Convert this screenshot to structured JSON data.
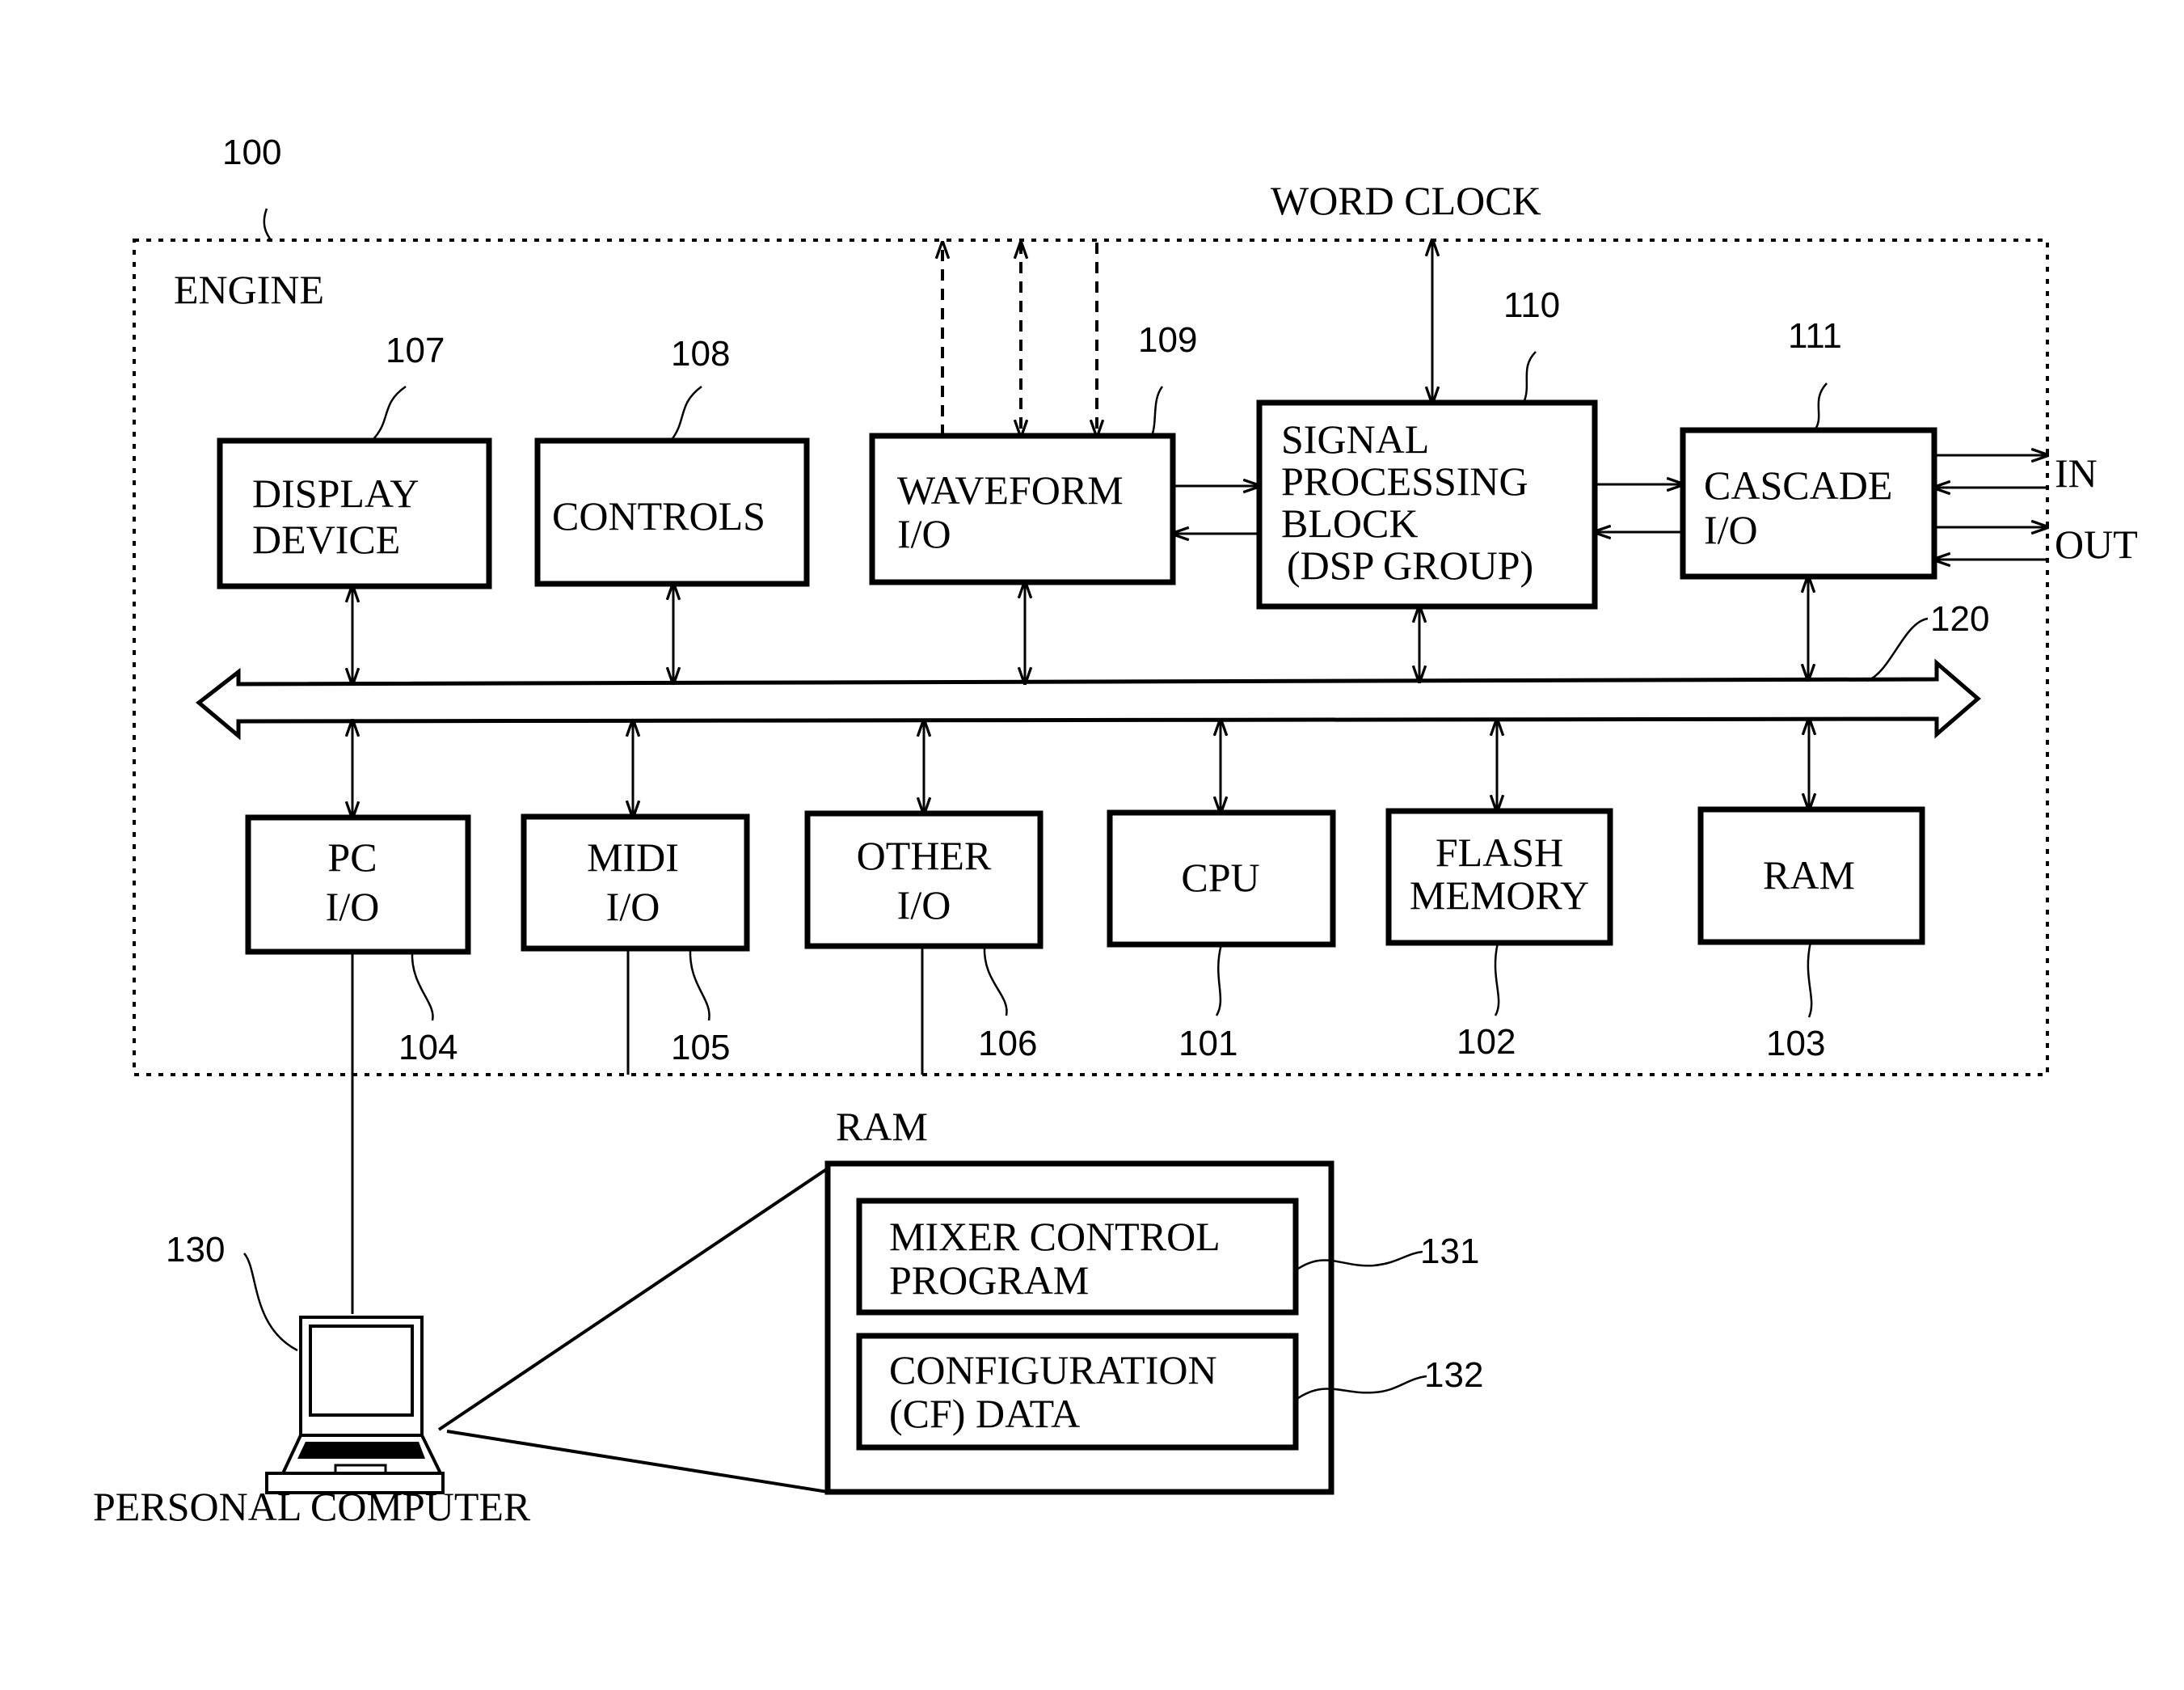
{
  "figure": {
    "engine": {
      "ref": "100",
      "label": "ENGINE"
    },
    "word_clock": "WORD CLOCK",
    "top_blocks": [
      {
        "ref": "107",
        "lines": [
          "DISPLAY",
          "DEVICE"
        ]
      },
      {
        "ref": "108",
        "lines": [
          "CONTROLS"
        ]
      },
      {
        "ref": "109",
        "lines": [
          "WAVEFORM",
          "I/O"
        ]
      },
      {
        "ref": "110",
        "lines": [
          "SIGNAL",
          "PROCESSING",
          "BLOCK",
          "(DSP GROUP)"
        ]
      },
      {
        "ref": "111",
        "lines": [
          "CASCADE",
          "I/O"
        ]
      }
    ],
    "bus": {
      "ref": "120"
    },
    "bottom_blocks": [
      {
        "ref": "104",
        "lines": [
          "PC",
          "I/O"
        ]
      },
      {
        "ref": "105",
        "lines": [
          "MIDI",
          "I/O"
        ]
      },
      {
        "ref": "106",
        "lines": [
          "OTHER",
          "I/O"
        ]
      },
      {
        "ref": "101",
        "lines": [
          "CPU"
        ]
      },
      {
        "ref": "102",
        "lines": [
          "FLASH",
          "MEMORY"
        ]
      },
      {
        "ref": "103",
        "lines": [
          "RAM"
        ]
      }
    ],
    "cascade_ports": {
      "in": "IN",
      "out": "OUT"
    },
    "personal_computer": {
      "ref": "130",
      "label": "PERSONAL COMPUTER"
    },
    "pc_ram": {
      "label": "RAM",
      "items": [
        {
          "ref": "131",
          "lines": [
            "MIXER CONTROL",
            "PROGRAM"
          ]
        },
        {
          "ref": "132",
          "lines": [
            "CONFIGURATION",
            "(CF) DATA"
          ]
        }
      ]
    }
  }
}
